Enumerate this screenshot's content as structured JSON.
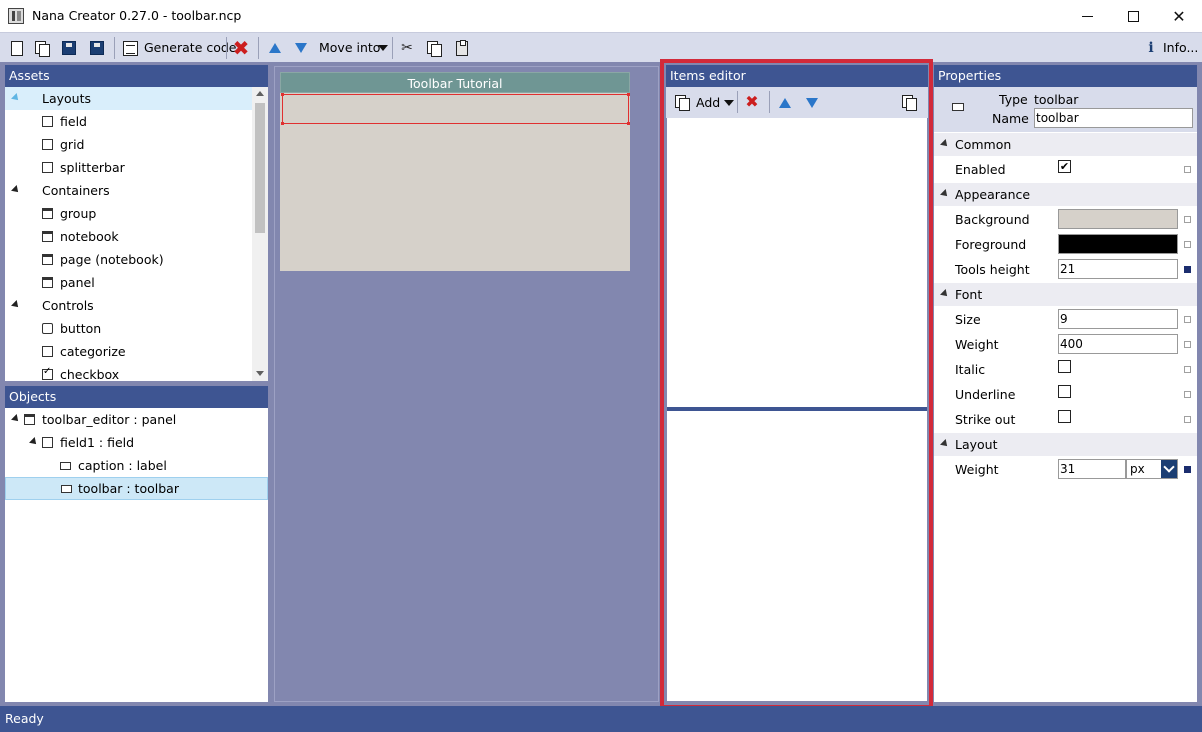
{
  "window": {
    "title": "Nana Creator 0.27.0 - toolbar.ncp",
    "minimize": "—",
    "maximize": "☐",
    "close": "✕"
  },
  "toolbar": {
    "generate_code": "Generate code",
    "move_into": "Move into",
    "info": "Info..."
  },
  "assets": {
    "title": "Assets",
    "items": [
      {
        "label": "Layouts",
        "kind": "group"
      },
      {
        "label": "field",
        "kind": "item"
      },
      {
        "label": "grid",
        "kind": "item"
      },
      {
        "label": "splitterbar",
        "kind": "item"
      },
      {
        "label": "Containers",
        "kind": "group"
      },
      {
        "label": "group",
        "kind": "item"
      },
      {
        "label": "notebook",
        "kind": "item"
      },
      {
        "label": "page (notebook)",
        "kind": "item"
      },
      {
        "label": "panel",
        "kind": "item"
      },
      {
        "label": "Controls",
        "kind": "group"
      },
      {
        "label": "button",
        "kind": "item"
      },
      {
        "label": "categorize",
        "kind": "item"
      },
      {
        "label": "checkbox",
        "kind": "item"
      }
    ]
  },
  "objects": {
    "title": "Objects",
    "items": [
      {
        "label": "toolbar_editor : panel"
      },
      {
        "label": "field1 : field"
      },
      {
        "label": "caption : label"
      },
      {
        "label": "toolbar : toolbar"
      }
    ]
  },
  "canvas": {
    "form_title": "Toolbar Tutorial"
  },
  "items_editor": {
    "title": "Items editor",
    "add_label": "Add"
  },
  "properties": {
    "title": "Properties",
    "type_label": "Type",
    "type_value": "toolbar",
    "name_label": "Name",
    "name_value": "toolbar",
    "groups": {
      "common": "Common",
      "appearance": "Appearance",
      "font": "Font",
      "layout": "Layout"
    },
    "rows": {
      "enabled": {
        "label": "Enabled",
        "checked": true
      },
      "background": {
        "label": "Background",
        "color": "#d6d1ca"
      },
      "foreground": {
        "label": "Foreground",
        "color": "#000000"
      },
      "tools_height": {
        "label": "Tools height",
        "value": "21"
      },
      "size": {
        "label": "Size",
        "value": "9"
      },
      "weight": {
        "label": "Weight",
        "value": "400"
      },
      "italic": {
        "label": "Italic",
        "checked": false
      },
      "underline": {
        "label": "Underline",
        "checked": false
      },
      "strike_out": {
        "label": "Strike out",
        "checked": false
      },
      "layout_weight": {
        "label": "Weight",
        "value": "31",
        "unit": "px"
      }
    }
  },
  "status": {
    "text": "Ready"
  },
  "colors": {
    "header_bg": "#3e5592",
    "workspace_bg": "#8287af",
    "highlight_frame": "#d22a3a"
  }
}
